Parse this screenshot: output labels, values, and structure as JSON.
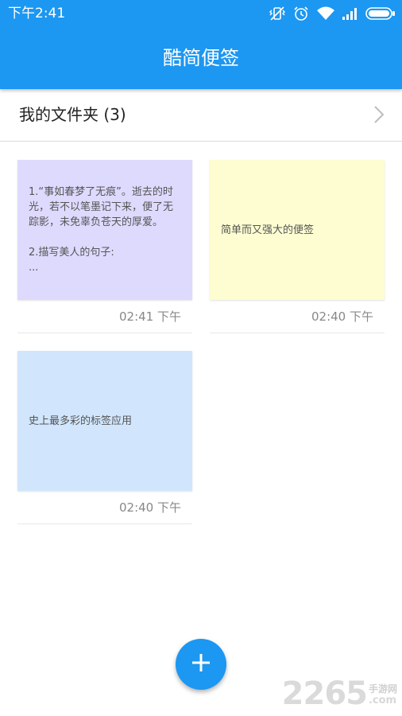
{
  "status_bar": {
    "time": "下午2:41",
    "icons": [
      "vibrate-off-icon",
      "alarm-icon",
      "wifi-icon",
      "signal-icon",
      "battery-icon"
    ]
  },
  "header": {
    "title": "酷简便签"
  },
  "folder": {
    "label": "我的文件夹 (3)"
  },
  "notes": [
    {
      "text": "1.“事如春梦了无痕”。逝去的时光，若不以笔墨记下来，便了无踪影，未免辜负苍天的厚爱。\n\n2.描写美人的句子:\n...",
      "time": "02:41 下午",
      "color": "#dedafe"
    },
    {
      "text": "简单而又强大的便签",
      "time": "02:40 下午",
      "color": "#fdfdd1"
    },
    {
      "text": "史上最多彩的标签应用",
      "time": "02:40 下午",
      "color": "#d1e6fd"
    }
  ],
  "fab": {
    "icon": "plus-icon"
  },
  "watermark": {
    "digits": "2265",
    "site_cn": "手游网",
    "site_suffix": ".com"
  },
  "colors": {
    "accent": "#1c97f2"
  }
}
